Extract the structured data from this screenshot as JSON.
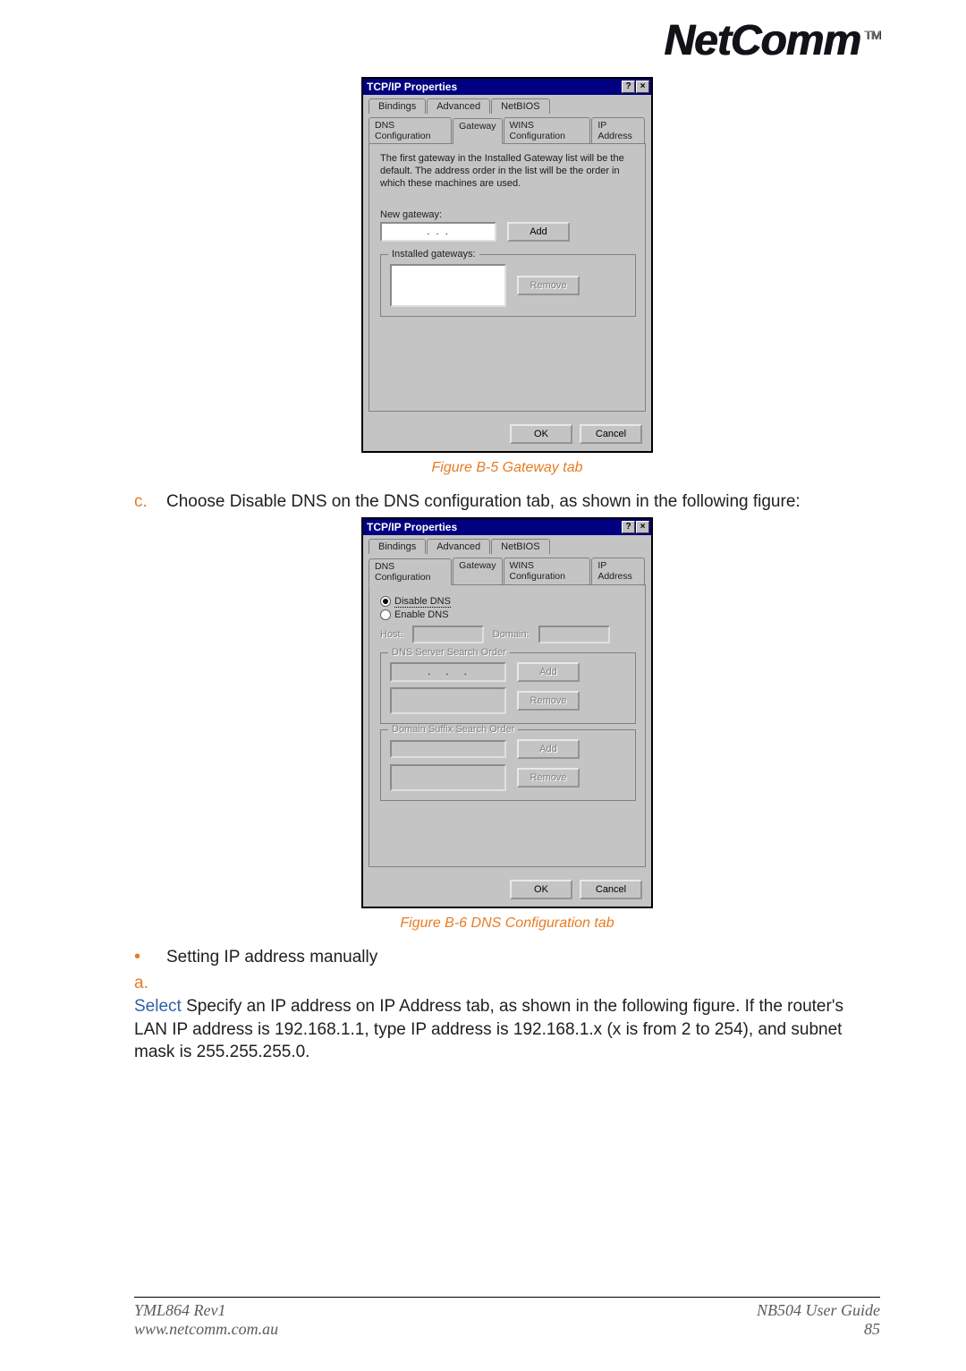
{
  "brand": {
    "name": "NetComm",
    "trademark": "TM"
  },
  "dialog1": {
    "title": "TCP/IP Properties",
    "help_icon": "?",
    "close_icon": "×",
    "tabs_row1": {
      "bindings": "Bindings",
      "advanced": "Advanced",
      "netbios": "NetBIOS"
    },
    "tabs_row2": {
      "dns": "DNS Configuration",
      "gateway": "Gateway",
      "wins": "WINS Configuration",
      "ip": "IP Address"
    },
    "info_text": "The first gateway in the Installed Gateway list will be the default. The address order in the list will be the order in which these machines are used.",
    "new_gateway_label": "New gateway:",
    "ip_dots": ".   .   .",
    "add_btn": "Add",
    "installed_label": "Installed gateways:",
    "remove_btn": "Remove",
    "ok_btn": "OK",
    "cancel_btn": "Cancel"
  },
  "caption1": "Figure B-5  Gateway tab",
  "step_c_marker": "c.",
  "step_c_text": "Choose Disable DNS on the DNS configuration tab, as shown in the following figure:",
  "dialog2": {
    "title": "TCP/IP Properties",
    "help_icon": "?",
    "close_icon": "×",
    "tabs_row1": {
      "bindings": "Bindings",
      "advanced": "Advanced",
      "netbios": "NetBIOS"
    },
    "tabs_row2": {
      "dns": "DNS Configuration",
      "gateway": "Gateway",
      "wins": "WINS Configuration",
      "ip": "IP Address"
    },
    "disable_dns": "Disable DNS",
    "enable_dns": "Enable DNS",
    "host_label": "Host:",
    "domain_label": "Domain:",
    "dns_order_legend": "DNS Server Search Order",
    "add_btn": "Add",
    "remove_btn": "Remove",
    "suffix_legend": "Domain Suffix Search Order",
    "add_btn2": "Add",
    "remove_btn2": "Remove",
    "ok_btn": "OK",
    "cancel_btn": "Cancel"
  },
  "caption2": "Figure B-6  DNS Configuration tab",
  "bullet_text": "Setting IP address manually",
  "step_a_marker": "a.",
  "select_word": "Select",
  "step_a_tail": " Specify an IP address on IP Address tab, as shown in the following figure. If the router's LAN IP address is 192.168.1.1, type IP address is 192.168.1.x (x is from 2 to 254), and subnet mask is 255.255.255.0.",
  "footer": {
    "left1": "YML864 Rev1",
    "left2": "www.netcomm.com.au",
    "right1": "NB504 User Guide",
    "right2": "85"
  }
}
